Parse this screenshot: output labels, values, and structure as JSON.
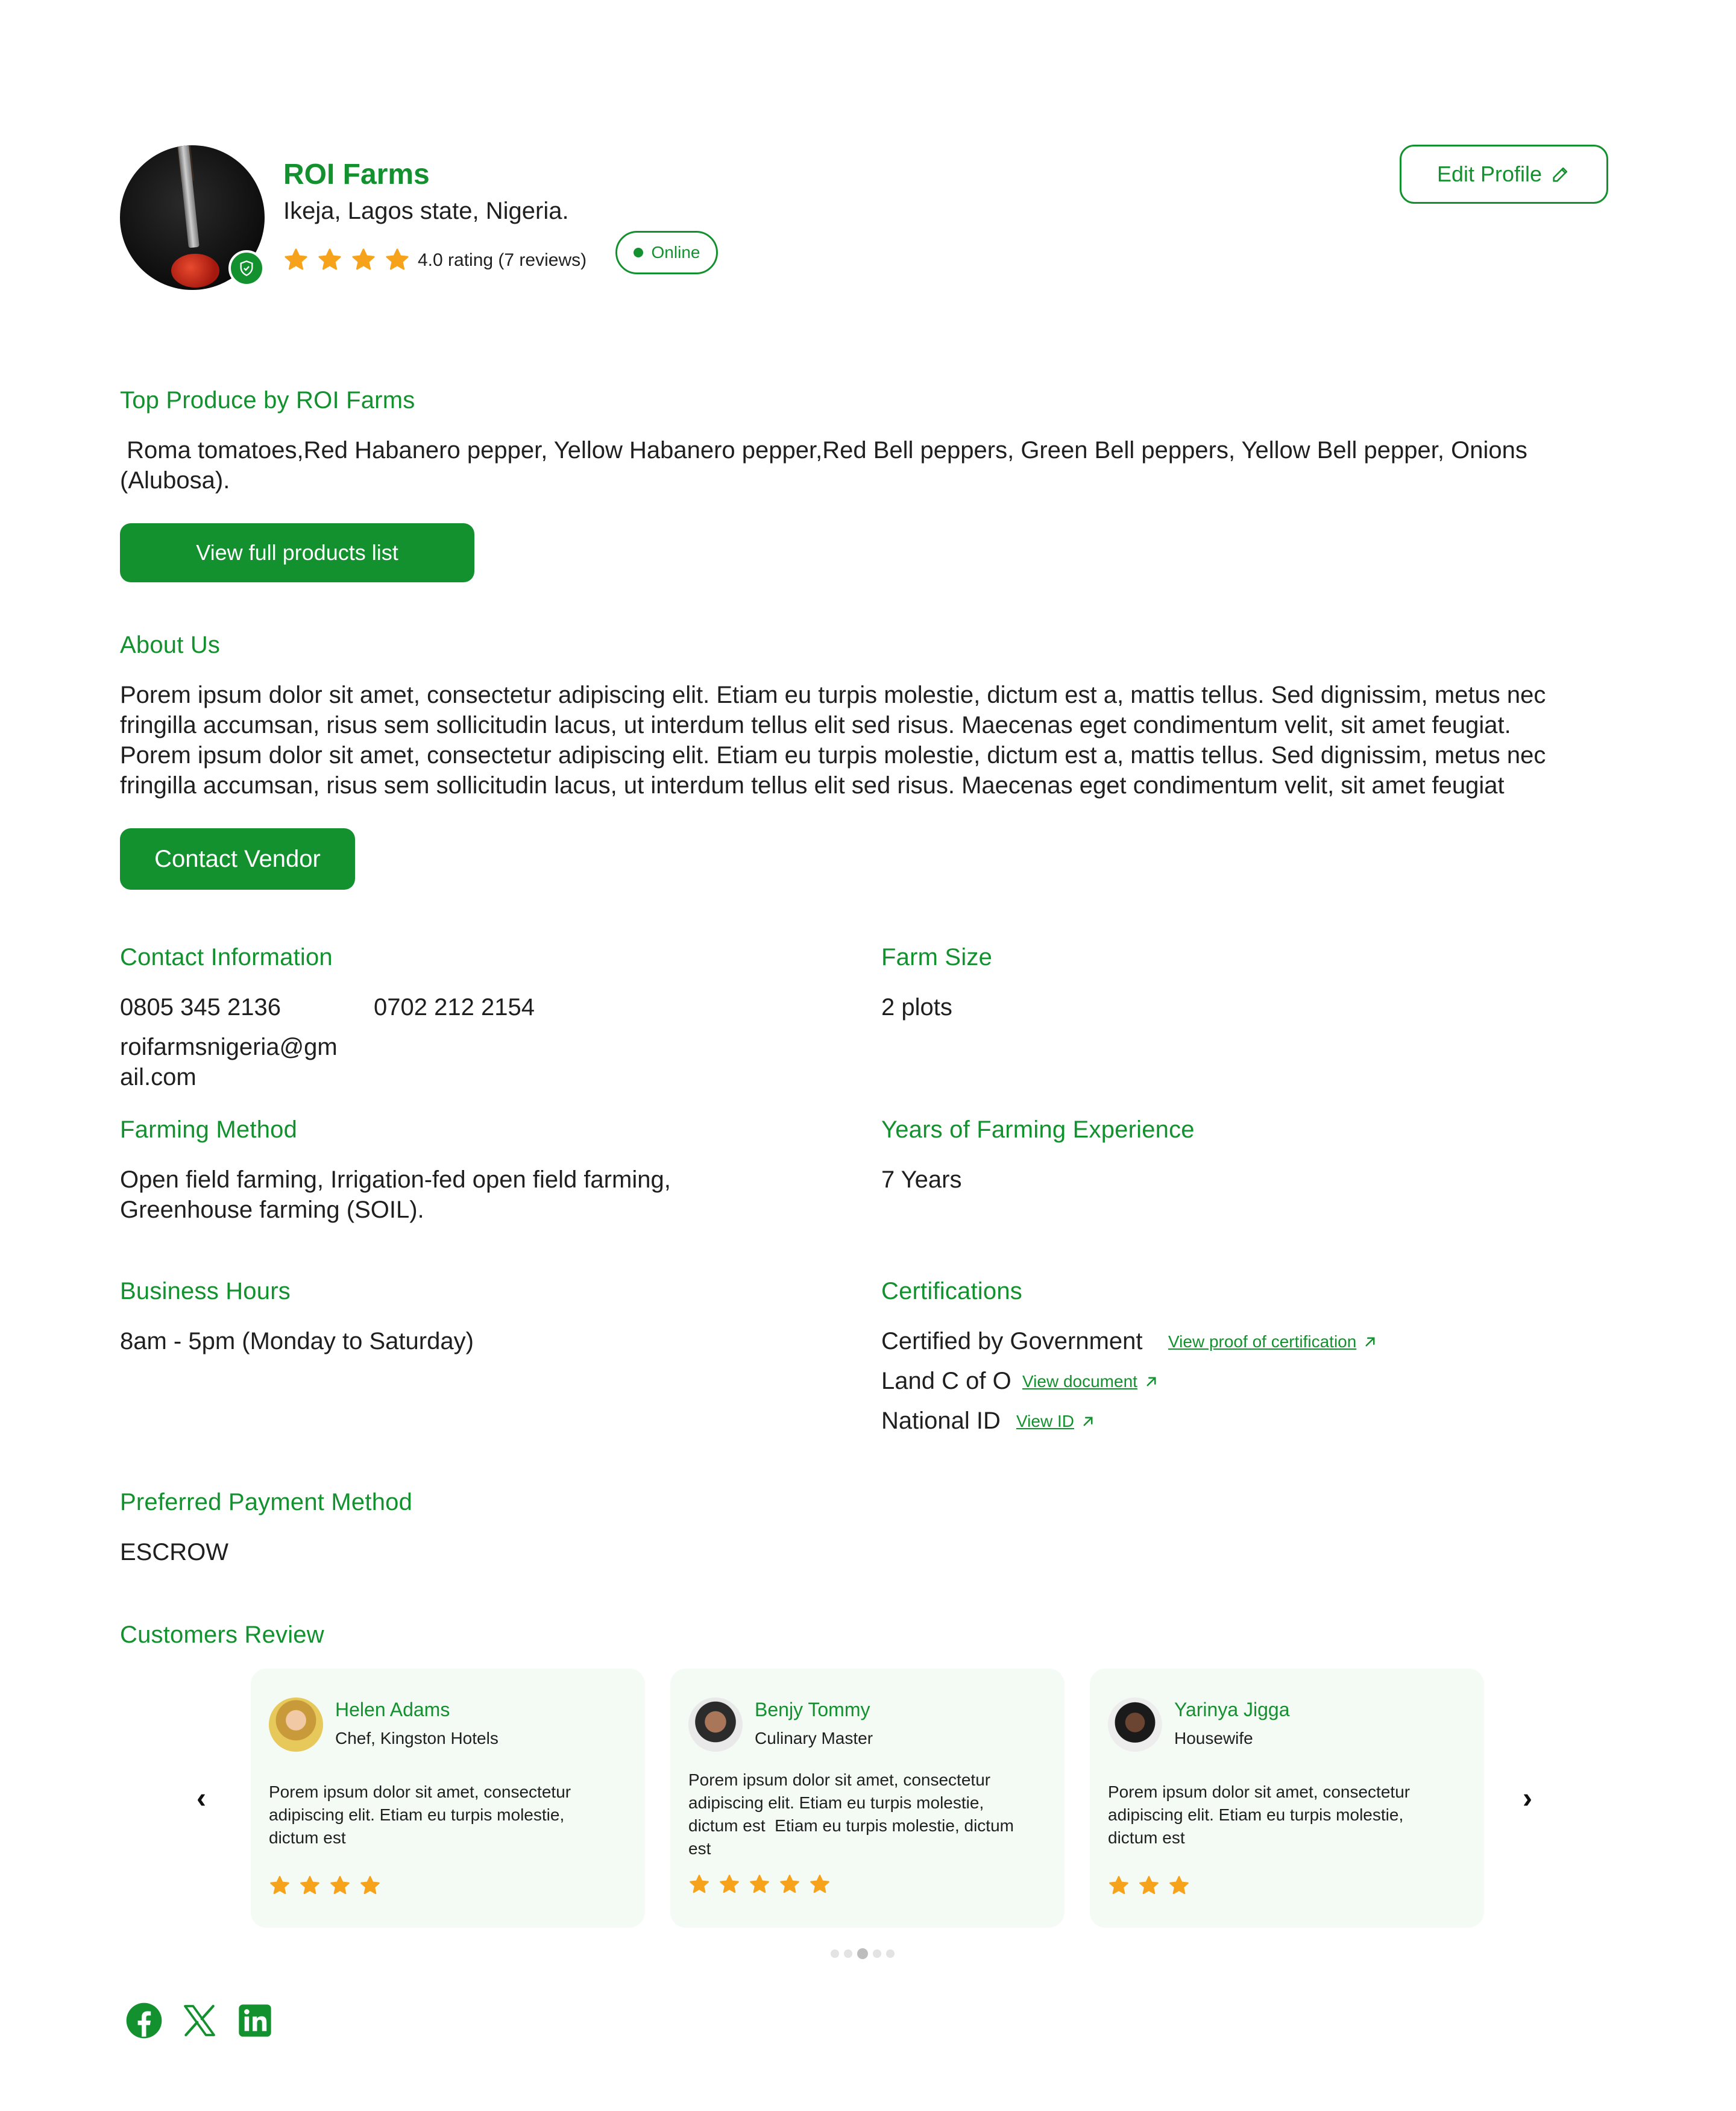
{
  "profile": {
    "name": "ROI Farms",
    "location": "Ikeja, Lagos state, Nigeria.",
    "rating_text": "4.0 rating (7 reviews)",
    "rating": 4,
    "status": "Online",
    "edit_label": "Edit Profile"
  },
  "top_produce": {
    "heading": "Top Produce by ROI Farms",
    "text_line1": " Roma tomatoes,Red Habanero pepper, Yellow Habanero pepper,Red Bell peppers, Green Bell peppers, Yellow Bell pepper, Onions",
    "text_line2": "(Alubosa).",
    "button": "View full products list"
  },
  "about": {
    "heading": "About Us",
    "lines": [
      "Porem ipsum dolor sit amet, consectetur adipiscing elit. Etiam eu turpis molestie, dictum est a, mattis tellus. Sed dignissim, metus nec",
      "fringilla accumsan, risus sem sollicitudin lacus, ut interdum tellus elit sed risus. Maecenas eget condimentum velit, sit amet feugiat.",
      "Porem ipsum dolor sit amet, consectetur adipiscing elit. Etiam eu turpis molestie, dictum est a, mattis tellus. Sed dignissim, metus nec",
      "fringilla accumsan, risus sem sollicitudin lacus, ut interdum tellus elit sed risus. Maecenas eget condimentum velit, sit amet feugiat"
    ],
    "button": "Contact Vendor"
  },
  "contact": {
    "heading": "Contact Information",
    "phone1": "0805 345 2136",
    "phone2": "0702 212 2154",
    "email_line1": "roifarmsnigeria@gm",
    "email_line2": "ail.com"
  },
  "farm_size": {
    "heading": "Farm Size",
    "value": "2 plots"
  },
  "farming_method": {
    "heading": "Farming Method",
    "line1": "Open field farming, Irrigation-fed open field farming,",
    "line2": "Greenhouse farming (SOIL)."
  },
  "experience": {
    "heading": "Years of Farming Experience",
    "value": "7 Years"
  },
  "business_hours": {
    "heading": "Business Hours",
    "value": "8am - 5pm (Monday to Saturday)"
  },
  "certifications": {
    "heading": "Certifications",
    "items": [
      {
        "label": "Certified by Government",
        "link": "View proof of certification"
      },
      {
        "label": "Land C of O",
        "link": "View document"
      },
      {
        "label": "National ID",
        "link": "View ID"
      }
    ]
  },
  "payment": {
    "heading": "Preferred Payment Method",
    "value": "ESCROW"
  },
  "reviews": {
    "heading": "Customers Review",
    "cards": [
      {
        "name": "Helen Adams",
        "role": "Chef, Kingston Hotels",
        "text": [
          "Porem ipsum dolor sit amet, consectetur",
          "adipiscing elit. Etiam eu turpis molestie,",
          "dictum est"
        ],
        "stars": 4
      },
      {
        "name": "Benjy Tommy",
        "role": "Culinary Master",
        "text": [
          "Porem ipsum dolor sit amet, consectetur",
          "adipiscing elit. Etiam eu turpis molestie,",
          "dictum est  Etiam eu turpis molestie, dictum",
          "est"
        ],
        "stars": 5
      },
      {
        "name": "Yarinya Jigga",
        "role": "Housewife",
        "text": [
          "Porem ipsum dolor sit amet, consectetur",
          "adipiscing elit. Etiam eu turpis molestie,",
          "dictum est"
        ],
        "stars": 3
      }
    ],
    "pagination_active": 3,
    "pagination_total": 5
  },
  "social": [
    "facebook-icon",
    "x-icon",
    "linkedin-icon"
  ],
  "colors": {
    "brand": "#13912f",
    "star": "#f7a21b",
    "card_bg": "#f4fbf4"
  }
}
